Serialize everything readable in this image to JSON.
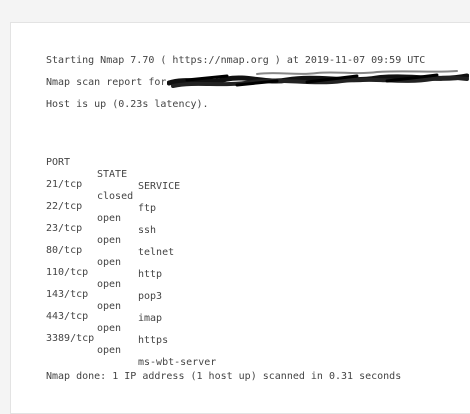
{
  "terminal": {
    "line_start": "Starting Nmap 7.70 ( https://nmap.org ) at 2019-11-07 09:59 UTC",
    "line_report": "Nmap scan report for",
    "line_host": "Host is up (0.23s latency).",
    "headers": {
      "port": "PORT",
      "state": "STATE",
      "service": "SERVICE"
    },
    "rows": [
      {
        "port": "21/tcp",
        "state": "closed",
        "service": "ftp"
      },
      {
        "port": "22/tcp",
        "state": "open",
        "service": "ssh"
      },
      {
        "port": "23/tcp",
        "state": "open",
        "service": "telnet"
      },
      {
        "port": "80/tcp",
        "state": "open",
        "service": "http"
      },
      {
        "port": "110/tcp",
        "state": "open",
        "service": "pop3"
      },
      {
        "port": "143/tcp",
        "state": "open",
        "service": "imap"
      },
      {
        "port": "443/tcp",
        "state": "open",
        "service": "https"
      },
      {
        "port": "3389/tcp",
        "state": "open",
        "service": "ms-wbt-server"
      }
    ],
    "line_done": "Nmap done: 1 IP address (1 host up) scanned in 0.31 seconds"
  }
}
